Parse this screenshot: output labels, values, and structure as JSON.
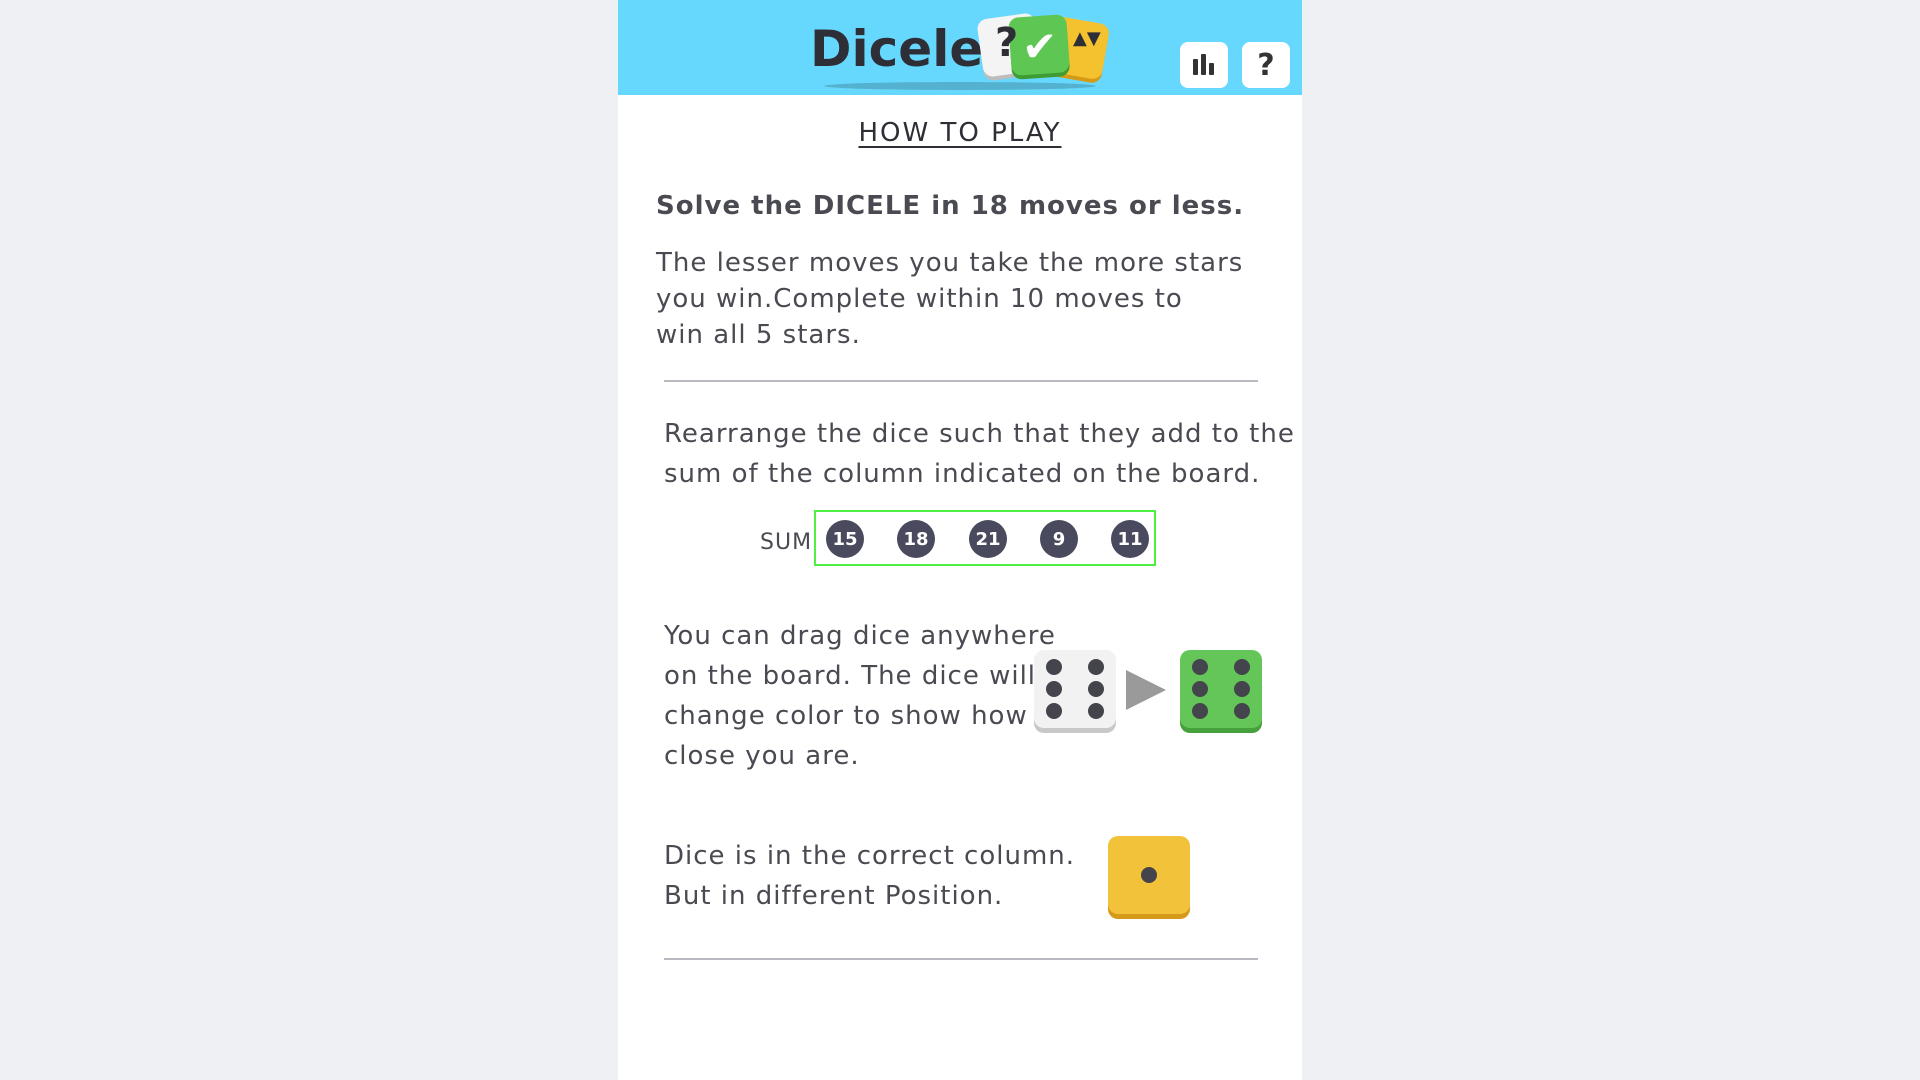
{
  "header": {
    "logo_text": "Dicele",
    "logo_question": "?",
    "logo_check": "✔",
    "logo_arrows": "▲▼",
    "stats_icon": "bar-chart-icon",
    "help_label": "?",
    "colors": {
      "bar": "#67d8fd"
    }
  },
  "content": {
    "title": "HOW TO PLAY",
    "intro_bold": "Solve the DICELE in 18 moves or less.",
    "intro_lines": [
      "The lesser moves you take the more stars",
      "you win.Complete within 10 moves to",
      "win all 5 stars."
    ],
    "rearrange_lines": [
      "Rearrange the dice such that they add to the",
      "sum of the column indicated on the board."
    ],
    "sum_label": "SUM",
    "sums": [
      "15",
      "18",
      "21",
      "9",
      "11"
    ],
    "drag_lines": [
      "You can drag dice anywhere",
      "on the board. The dice will",
      "change color to show how",
      "close you are."
    ],
    "drag_example": {
      "before_face": 6,
      "after_face": 6,
      "before_color": "#f2f2f2",
      "after_color": "#64c659"
    },
    "yellow_lines": [
      "Dice is in the correct column.",
      "But in different Position."
    ],
    "yellow_example": {
      "face": 1,
      "color": "#f3c23b"
    }
  }
}
